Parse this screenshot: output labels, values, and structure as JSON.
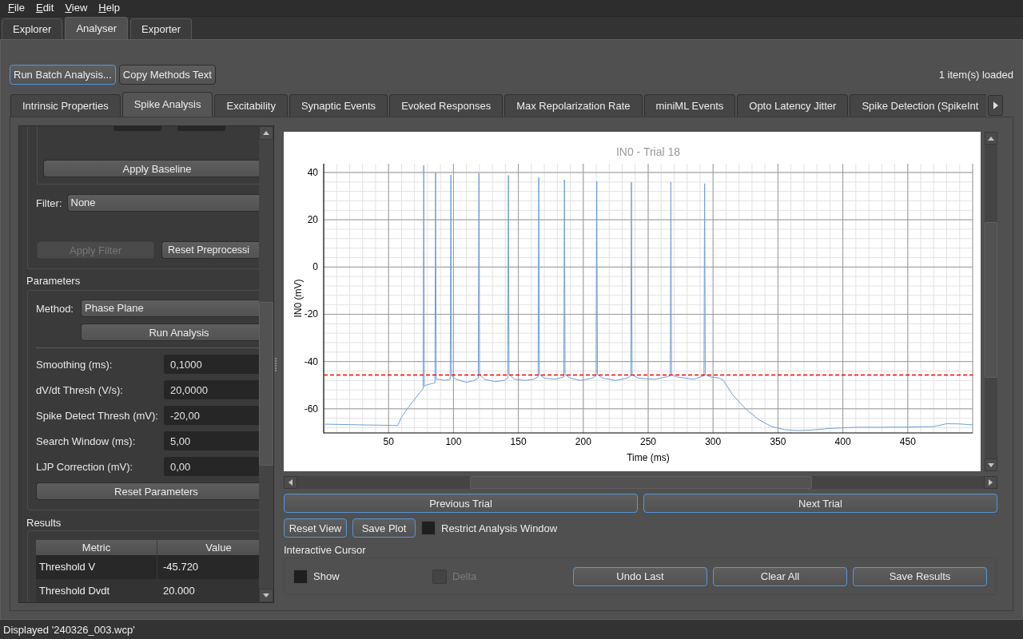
{
  "menu_bar": {
    "items": [
      "File",
      "Edit",
      "View",
      "Help"
    ]
  },
  "main_tabs": [
    {
      "label": "Explorer",
      "selected": false
    },
    {
      "label": "Analyser",
      "selected": true
    },
    {
      "label": "Exporter",
      "selected": false
    }
  ],
  "toolbar": {
    "buttons": [
      {
        "label": "Run Batch Analysis...",
        "highlighted": true
      },
      {
        "label": "Copy Methods Text",
        "highlighted": false
      }
    ],
    "status": "1 item(s) loaded"
  },
  "analysis_tabs": [
    {
      "label": "Intrinsic Properties",
      "selected": false
    },
    {
      "label": "Spike Analysis",
      "selected": true
    },
    {
      "label": "Excitability",
      "selected": false
    },
    {
      "label": "Synaptic Events",
      "selected": false
    },
    {
      "label": "Evoked Responses",
      "selected": false
    },
    {
      "label": "Max Repolarization Rate",
      "selected": false
    },
    {
      "label": "miniML Events",
      "selected": false
    },
    {
      "label": "Opto Latency Jitter",
      "selected": false
    },
    {
      "label": "Spike Detection (SpikeInt",
      "selected": false
    }
  ],
  "preprocessing": {
    "baseline_inputs": [
      {
        "kind": "spin-box"
      },
      {
        "kind": "spin-box"
      }
    ],
    "apply_baseline": {
      "label": "Apply Baseline",
      "highlighted": false
    },
    "filter": {
      "label": "Filter:",
      "value": "None"
    },
    "buttons": [
      {
        "label": "Apply Filter",
        "highlighted": false,
        "disabled": true
      },
      {
        "label": "Reset Preprocessi",
        "highlighted": false,
        "disabled": false
      }
    ]
  },
  "parameters": {
    "title": "Parameters",
    "method": {
      "label": "Method:",
      "value": "Phase Plane"
    },
    "run_button": {
      "label": "Run Analysis",
      "highlighted": false
    },
    "fields": [
      {
        "label": "Smoothing (ms):",
        "value": "0,1000"
      },
      {
        "label": "dV/dt Thresh (V/s):",
        "value": "20,0000"
      },
      {
        "label": "Spike Detect Thresh (mV):",
        "value": "-20,00"
      },
      {
        "label": "Search Window (ms):",
        "value": "5,00"
      },
      {
        "label": "LJP Correction (mV):",
        "value": "0,00"
      }
    ],
    "reset_button": {
      "label": "Reset Parameters",
      "highlighted": false
    }
  },
  "results": {
    "title": "Results",
    "table": {
      "columns": [
        "Metric",
        "Value"
      ],
      "rows": [
        [
          "Threshold V",
          "-45.720"
        ],
        [
          "Threshold Dvdt",
          "20.000"
        ]
      ]
    }
  },
  "plot": {
    "chart_data": {
      "type": "line",
      "title": "IN0 - Trial 18",
      "xlabel": "Time (ms)",
      "ylabel": "IN0 (mV)",
      "x": [
        0,
        10,
        20,
        30,
        40,
        50,
        57,
        60,
        65,
        70,
        75,
        76.6,
        77.1,
        77.6,
        79,
        82,
        85.7,
        86.2,
        86.7,
        89,
        93,
        97.5,
        98,
        98.5,
        102,
        110,
        116,
        119.1,
        119.6,
        120.1,
        124,
        132,
        139,
        141.8,
        142.3,
        142.8,
        147,
        155,
        162,
        165.2,
        165.7,
        166.2,
        170,
        178,
        185,
        185.5,
        186,
        190,
        198,
        207,
        209.9,
        210.4,
        210.9,
        215,
        225,
        234,
        236.6,
        237.1,
        237.6,
        242,
        255,
        264,
        267,
        267.5,
        268,
        272,
        285,
        293,
        293.5,
        294,
        298,
        305,
        308,
        315,
        325,
        335,
        345,
        355,
        365,
        375,
        390,
        410,
        430,
        450,
        470,
        480,
        490,
        500
      ],
      "series": [
        {
          "color": "#6f9fd8",
          "values": [
            -66.5,
            -66.6,
            -66.7,
            -66.8,
            -66.9,
            -67.0,
            -67.1,
            -63.5,
            -59.5,
            -56.0,
            -52.5,
            -51.5,
            43.0,
            -50.5,
            -50.0,
            -49.5,
            -49.0,
            40.0,
            -47.5,
            -47.5,
            -48.0,
            -47.5,
            39.0,
            -46.0,
            -47.5,
            -48.8,
            -48.0,
            -47.0,
            39.6,
            -45.5,
            -47.5,
            -48.5,
            -48.0,
            -47.0,
            38.8,
            -45.5,
            -47.5,
            -48.0,
            -47.5,
            -46.5,
            37.9,
            -45.5,
            -47.0,
            -47.5,
            -46.5,
            36.9,
            -45.5,
            -47.0,
            -48.0,
            -47.0,
            -46.0,
            36.3,
            -45.5,
            -47.0,
            -48.0,
            -47.0,
            -46.0,
            35.9,
            -45.5,
            -47.0,
            -47.5,
            -46.5,
            -46.0,
            35.9,
            -45.5,
            -46.5,
            -47.5,
            -46.0,
            35.3,
            -45.5,
            -46.5,
            -47.0,
            -48.0,
            -54.0,
            -60.0,
            -64.5,
            -67.5,
            -68.8,
            -69.2,
            -69.0,
            -68.3,
            -67.8,
            -67.8,
            -67.7,
            -67.5,
            -66.3,
            -66.4,
            -66.8
          ]
        }
      ],
      "xlim": [
        0,
        500
      ],
      "ylim": [
        -70.2,
        43.7
      ],
      "xticks": [
        50,
        100,
        150,
        200,
        250,
        300,
        350,
        400,
        450
      ],
      "yticks": [
        -60,
        -40,
        -20,
        0,
        20,
        40
      ],
      "grid": true,
      "ref_lines": [
        {
          "axis": "y",
          "value": -45.72,
          "color": "#ff0000"
        }
      ]
    }
  },
  "trial_navigation": [
    {
      "label": "Previous Trial",
      "highlighted": true
    },
    {
      "label": "Next Trial",
      "highlighted": true
    }
  ],
  "view_controls": {
    "buttons": [
      {
        "label": "Reset View",
        "highlighted": true
      },
      {
        "label": "Save Plot",
        "highlighted": true
      }
    ],
    "restrict_window": {
      "label": "Restrict Analysis Window",
      "checked": false
    }
  },
  "interactive_cursor": {
    "title": "Interactive Cursor",
    "checkboxes": [
      {
        "label": "Show",
        "checked": false,
        "disabled": false
      },
      {
        "label": "Delta",
        "checked": false,
        "disabled": true
      }
    ],
    "buttons": [
      {
        "label": "Undo Last",
        "highlighted": true
      },
      {
        "label": "Clear All",
        "highlighted": true
      },
      {
        "label": "Save Results",
        "highlighted": true
      }
    ]
  },
  "status_bar": {
    "text": "Displayed '240326_003.wcp'"
  }
}
